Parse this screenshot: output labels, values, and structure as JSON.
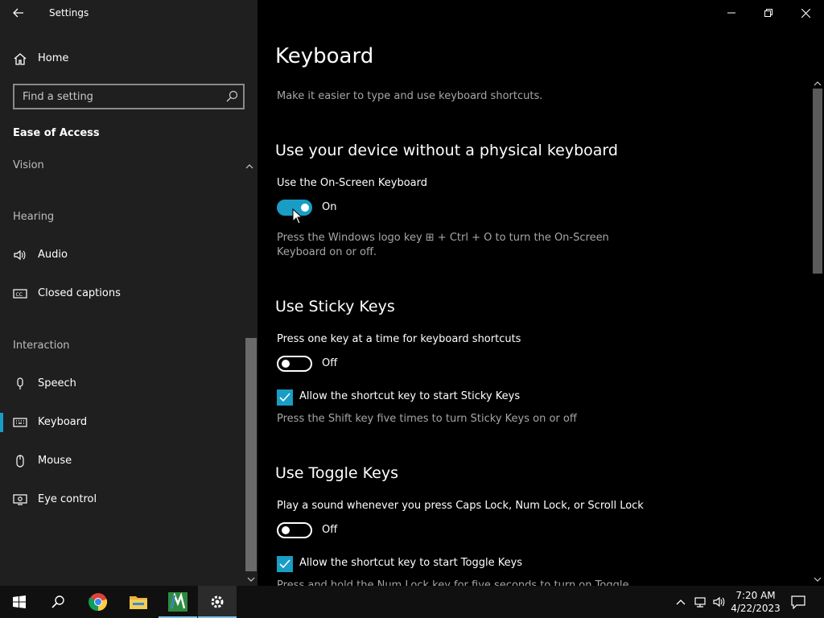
{
  "window": {
    "title": "Settings"
  },
  "sidebar": {
    "home_label": "Home",
    "search": {
      "placeholder": "Find a setting",
      "value": ""
    },
    "section_title": "Ease of Access",
    "groups": {
      "vision": "Vision",
      "hearing": "Hearing",
      "interaction": "Interaction"
    },
    "items": {
      "audio": "Audio",
      "closed_captions": "Closed captions",
      "speech": "Speech",
      "keyboard": "Keyboard",
      "mouse": "Mouse",
      "eye_control": "Eye control"
    },
    "selected": "Keyboard"
  },
  "main": {
    "title": "Keyboard",
    "description": "Make it easier to type and use keyboard shortcuts.",
    "osk": {
      "heading": "Use your device without a physical keyboard",
      "label": "Use the On-Screen Keyboard",
      "state": "On",
      "hint_line1": "Press the Windows logo key ⊞ + Ctrl + O to turn the On-Screen",
      "hint_line2": "Keyboard on or off."
    },
    "sticky": {
      "heading": "Use Sticky Keys",
      "label": "Press one key at a time for keyboard shortcuts",
      "state": "Off",
      "checkbox_label": "Allow the shortcut key to start Sticky Keys",
      "hint": "Press the Shift key five times to turn Sticky Keys on or off"
    },
    "toggle_keys": {
      "heading": "Use Toggle Keys",
      "label": "Play a sound whenever you press Caps Lock, Num Lock, or Scroll Lock",
      "state": "Off",
      "checkbox_label": "Allow the shortcut key to start Toggle Keys",
      "hint_partial": "Press and hold the Num Lock key for five seconds to turn on Toggle"
    }
  },
  "taskbar": {
    "time": "7:20 AM",
    "date": "4/22/2023"
  },
  "colors": {
    "accent": "#1a9dc4",
    "sidebar_bg": "#1f1f1f",
    "main_bg": "#000000"
  }
}
